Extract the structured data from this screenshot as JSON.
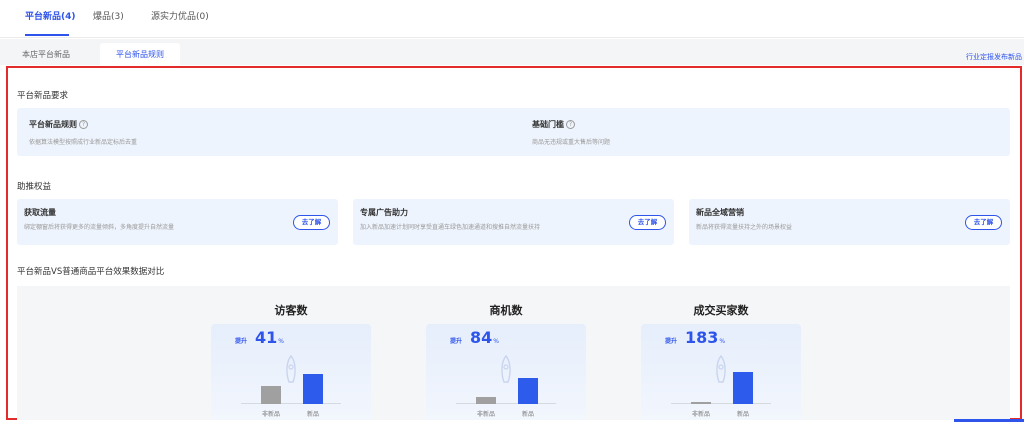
{
  "top_tabs": [
    {
      "label": "平台新品(4)",
      "active": true
    },
    {
      "label": "爆品(3)",
      "active": false
    },
    {
      "label": "源实力优品(0)",
      "active": false
    }
  ],
  "sub_tabs": [
    {
      "label": "本店平台新品",
      "active": false
    },
    {
      "label": "平台新品规则",
      "active": true
    }
  ],
  "top_right_link": "行业定报发布新品",
  "requirements": {
    "title": "平台新品要求",
    "items": [
      {
        "title": "平台新品规则",
        "desc": "依据算法模型按照成行业新品定标后去重"
      },
      {
        "title": "基础门槛",
        "desc": "商品无违规或重大售后等问题"
      }
    ]
  },
  "benefits": {
    "title": "助推权益",
    "button_label": "去了解",
    "items": [
      {
        "title": "获取流量",
        "desc": "绑定棚窗后将获得更多的流量倾斜，多角度提升自然流量"
      },
      {
        "title": "专属广告助力",
        "desc": "加入新品加速计划同时享受直通车绿色加速通道和搜推自然流量扶持"
      },
      {
        "title": "新品全域营销",
        "desc": "新品将获得流量扶持之外的场景权益"
      }
    ]
  },
  "comparison": {
    "title": "平台新品VS普通商品平台效果数据对比",
    "lift_label": "提升",
    "unit": "%",
    "old_label": "非新品",
    "new_label": "新品",
    "metrics": [
      {
        "title": "访客数",
        "lift": "41",
        "old_ratio": 0.55,
        "new_ratio": 0.95
      },
      {
        "title": "商机数",
        "lift": "84",
        "old_ratio": 0.22,
        "new_ratio": 0.82
      },
      {
        "title": "成交买家数",
        "lift": "183",
        "old_ratio": 0.05,
        "new_ratio": 1.0
      }
    ]
  },
  "colors": {
    "accent": "#2f54eb",
    "highlight_frame": "#e32b2b",
    "new_bar": "#2d5bec",
    "old_bar": "#a0a0a0"
  }
}
